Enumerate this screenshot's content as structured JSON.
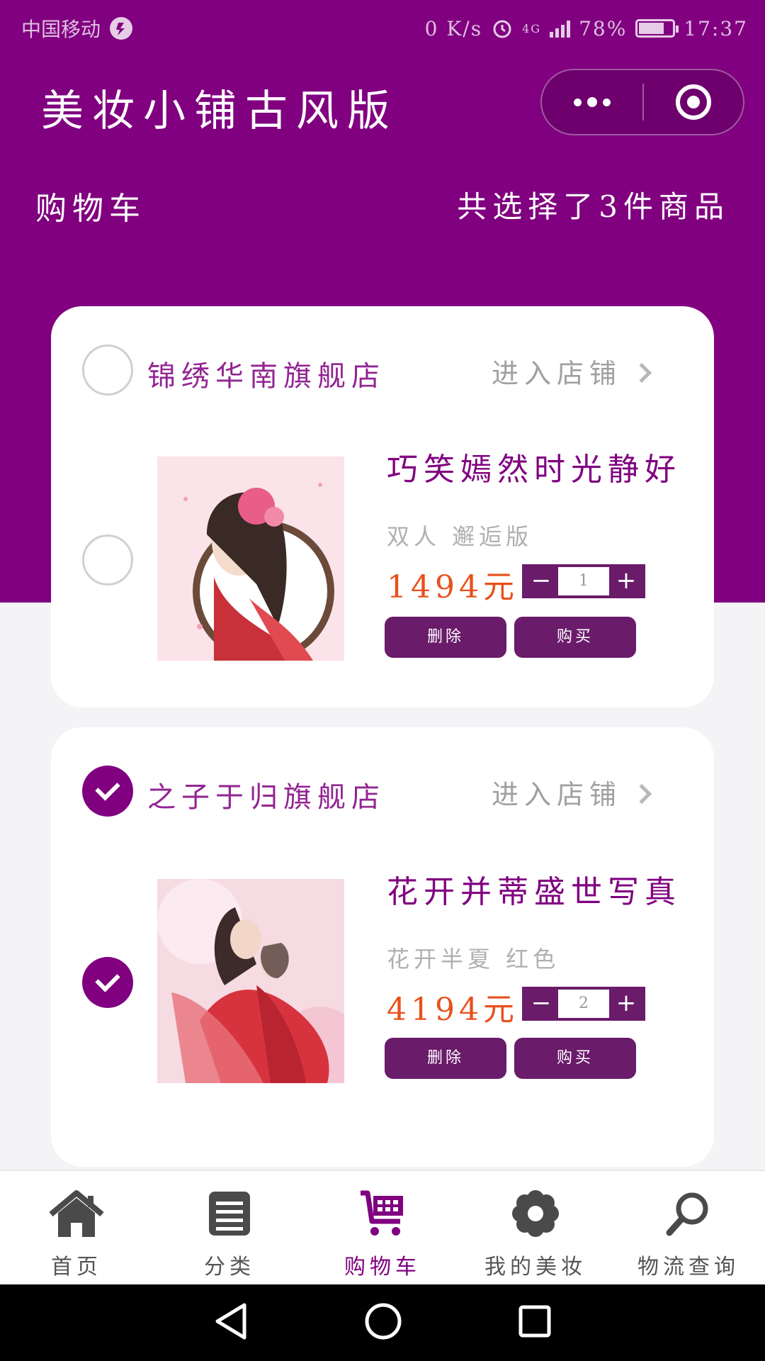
{
  "status_bar": {
    "carrier": "中国移动",
    "speed": "0 K/s",
    "battery": "78%",
    "time": "17:37",
    "network": "4G"
  },
  "nav": {
    "title": "美妆小铺古风版"
  },
  "header": {
    "cart_label": "购物车",
    "summary": "共选择了3件商品"
  },
  "shops": [
    {
      "name": "锦绣华南旗舰店",
      "enter_label": "进入店铺",
      "selected": false,
      "product": {
        "title": "巧笑嫣然时光静好",
        "spec": "双人 邂逅版",
        "price": "1494元",
        "quantity": "1",
        "selected": false,
        "delete_label": "删除",
        "buy_label": "购买"
      }
    },
    {
      "name": "之子于归旗舰店",
      "enter_label": "进入店铺",
      "selected": true,
      "product": {
        "title": "花开并蒂盛世写真",
        "spec": "花开半夏 红色",
        "price": "4194元",
        "quantity": "2",
        "selected": true,
        "delete_label": "删除",
        "buy_label": "购买"
      }
    }
  ],
  "stepper": {
    "minus": "−",
    "plus": "+"
  },
  "tabbar": [
    {
      "label": "首页",
      "icon": "home-icon"
    },
    {
      "label": "分类",
      "icon": "list-icon"
    },
    {
      "label": "购物车",
      "icon": "cart-icon",
      "active": true
    },
    {
      "label": "我的美妆",
      "icon": "flower-icon"
    },
    {
      "label": "物流查询",
      "icon": "search-icon"
    }
  ],
  "colors": {
    "primary": "#800080",
    "button": "#6a1b6a",
    "price": "#e8501c"
  }
}
